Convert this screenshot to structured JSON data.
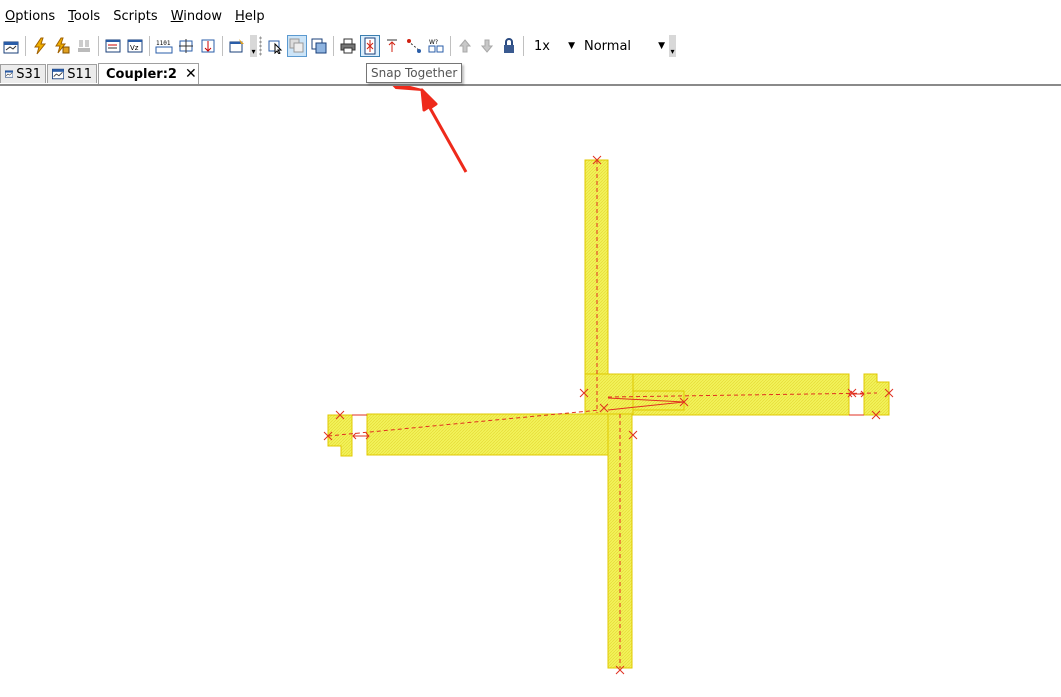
{
  "menu": {
    "items": [
      {
        "pre": "",
        "ul": "O",
        "post": "ptions"
      },
      {
        "pre": "",
        "ul": "T",
        "post": "ools"
      },
      {
        "pre": "Scripts",
        "ul": "",
        "post": ""
      },
      {
        "pre": "",
        "ul": "W",
        "post": "indow"
      },
      {
        "pre": "",
        "ul": "H",
        "post": "elp"
      }
    ]
  },
  "toolbar": {
    "zoom_value": "1x",
    "mode_value": "Normal"
  },
  "tabs": [
    {
      "label": "S31",
      "active": false
    },
    {
      "label": "S11",
      "active": false
    },
    {
      "label": "Coupler:2",
      "active": true,
      "close": "✕"
    }
  ],
  "tooltip": {
    "text": "Snap Together"
  },
  "colors": {
    "layout_fill": "#f2f25a",
    "layout_stroke": "#e0c800",
    "line_red": "#e03020",
    "arrow_red": "#ee2a1b"
  }
}
